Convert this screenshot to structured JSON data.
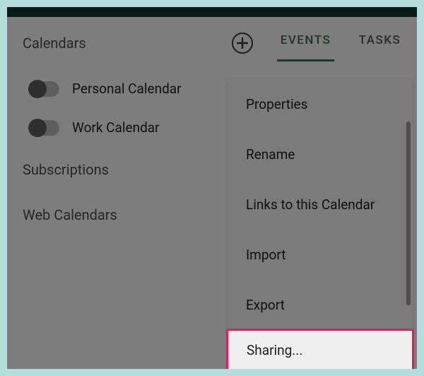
{
  "sidebar": {
    "title": "Calendars",
    "calendars": [
      {
        "label": "Personal Calendar"
      },
      {
        "label": "Work Calendar"
      }
    ],
    "sections": [
      "Subscriptions",
      "Web Calendars"
    ]
  },
  "tabs": {
    "events": "EVENTS",
    "tasks": "TASKS"
  },
  "menu": {
    "properties": "Properties",
    "rename": "Rename",
    "links": "Links to this Calendar",
    "import": "Import",
    "export": "Export",
    "sharing": "Sharing..."
  }
}
